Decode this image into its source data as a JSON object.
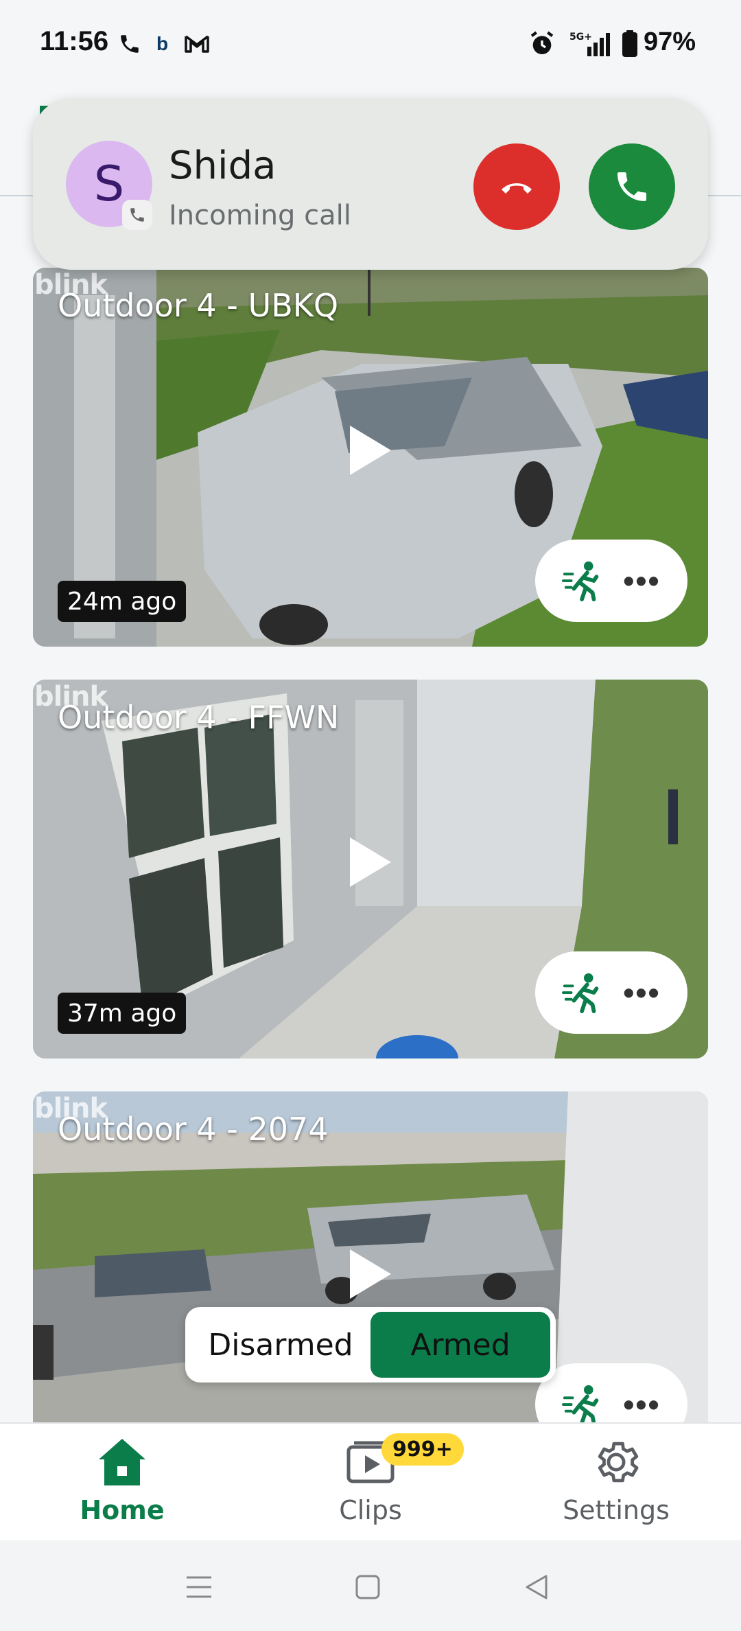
{
  "status_bar": {
    "time": "11:56",
    "battery_text": "97%",
    "network": "5G+"
  },
  "incoming_call": {
    "avatar_letter": "S",
    "caller_name": "Shida",
    "subtitle": "Incoming call",
    "decline_icon": "phone-hangup-icon",
    "accept_icon": "phone-icon"
  },
  "cameras": [
    {
      "logo": "blink",
      "title": "Outdoor 4 - UBKQ",
      "time_ago": "24m ago"
    },
    {
      "logo": "blink",
      "title": "Outdoor 4 - FFWN",
      "time_ago": "37m ago"
    },
    {
      "logo": "blink",
      "title": "Outdoor 4 - 2074",
      "time_ago": ""
    }
  ],
  "arm_toggle": {
    "disarmed_label": "Disarmed",
    "armed_label": "Armed",
    "selected": "Armed"
  },
  "bottom_nav": {
    "home_label": "Home",
    "clips_label": "Clips",
    "clips_badge": "999+",
    "settings_label": "Settings"
  },
  "colors": {
    "brand_green": "#0b7d4a",
    "decline_red": "#dc2f2c",
    "accept_green": "#1b8a3c",
    "badge_yellow": "#ffd93a"
  }
}
